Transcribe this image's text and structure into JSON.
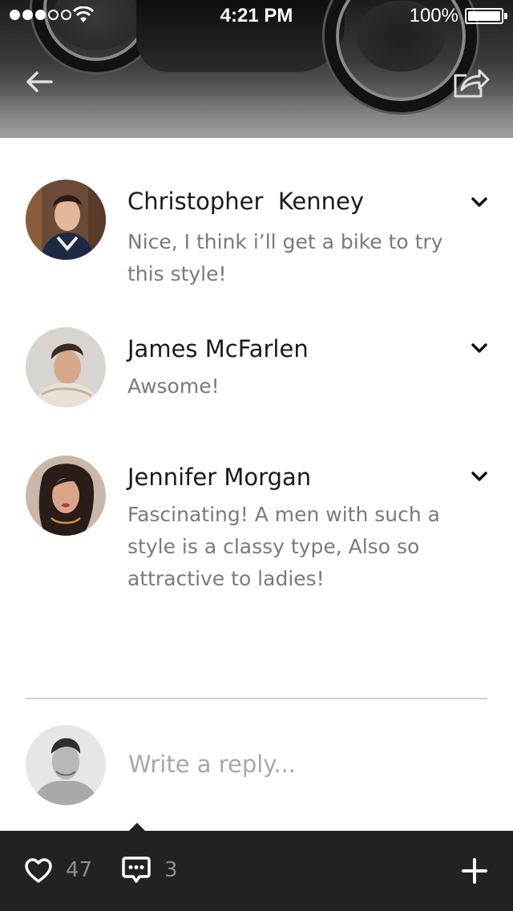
{
  "status_bar": {
    "time": "4:21 PM",
    "battery": "100%",
    "signal_bars_filled": 3,
    "signal_bars_total": 5
  },
  "header": {
    "back_icon": "arrow-left-icon",
    "share_icon": "share-icon"
  },
  "comments": [
    {
      "name": "Christopher  Kenney",
      "text": "Nice, I think i’ll get a bike to try this style!",
      "menu_icon": "chevron-down-icon"
    },
    {
      "name": "James McFarlen",
      "text": "Awsome!",
      "menu_icon": "chevron-down-icon"
    },
    {
      "name": "Jennifer Morgan",
      "text": "Fascinating! A men with such a style is a classy type, Also so attractive to ladies!",
      "menu_icon": "chevron-down-icon"
    }
  ],
  "reply": {
    "placeholder": "Write a reply...",
    "value": ""
  },
  "toolbar": {
    "likes": "47",
    "comments": "3",
    "like_icon": "heart-icon",
    "comment_icon": "comment-icon",
    "add_icon": "plus-icon"
  },
  "colors": {
    "bottom_bar": "#222222",
    "name_text": "#1a1a1a",
    "body_text": "#7a7a7a",
    "placeholder": "#a8a8a8"
  }
}
